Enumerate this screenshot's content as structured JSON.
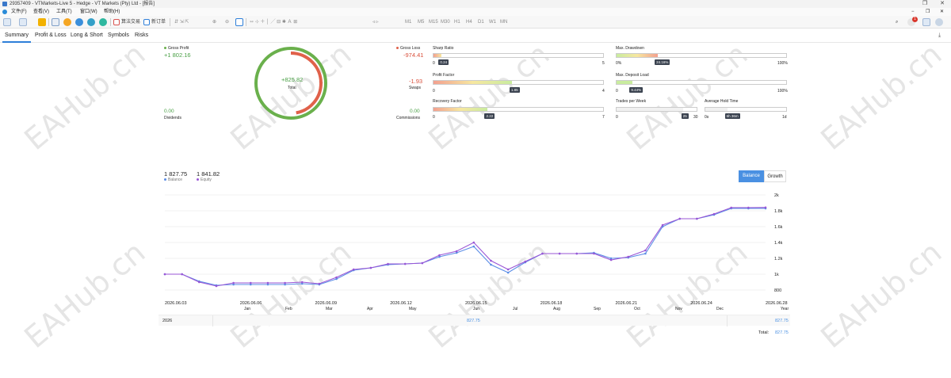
{
  "window": {
    "title": "29357409 - VTMarkets-Live 5 - Hedge - VT Markets (Pty) Ltd - [报告]",
    "buttons": [
      "❐",
      "✕"
    ]
  },
  "menu": {
    "items": [
      "文件(F)",
      "查看(V)",
      "工具(T)",
      "窗口(W)",
      "帮助(H)"
    ],
    "right_controls": [
      "−",
      "❐",
      "✕"
    ]
  },
  "toolbar": {
    "algo_label": "算法交易",
    "new_order_label": "新订单",
    "timeframes": [
      "M1",
      "M5",
      "M15",
      "M30",
      "H1",
      "H4",
      "D1",
      "W1",
      "MN"
    ],
    "notification_count": "1"
  },
  "tabs": [
    "Summary",
    "Profit & Loss",
    "Long & Short",
    "Symbols",
    "Risks"
  ],
  "summary": {
    "gross_profit_label": "Gross Profit",
    "gross_profit_value": "+1 802.16",
    "gross_loss_label": "Gross Loss",
    "gross_loss_value": "-974.41",
    "total_value": "+825.82",
    "total_label": "Total",
    "dividends_value": "0.00",
    "dividends_label": "Dividends",
    "swaps_value": "-1.93",
    "swaps_label": "Swaps",
    "commissions_value": "0.00",
    "commissions_label": "Commissions",
    "ring_profit_fraction": 0.649
  },
  "metrics": {
    "sharp_ratio": {
      "label": "Sharp Ratio",
      "value": "0.24",
      "min": "0",
      "max": "5",
      "fraction": 0.048
    },
    "profit_factor": {
      "label": "Profit Factor",
      "value": "1.85",
      "min": "0",
      "max": "4",
      "fraction": 0.4625
    },
    "recovery_factor": {
      "label": "Recovery Factor",
      "value": "2.22",
      "min": "0",
      "max": "7",
      "fraction": 0.317
    },
    "max_drawdown": {
      "label": "Max. Drawdown",
      "value": "24.16%",
      "min": "0%",
      "max": "100%",
      "fraction": 0.2416
    },
    "max_deposit_load": {
      "label": "Max. Deposit Load",
      "value": "9.44%",
      "min": "0",
      "max": "100%",
      "fraction": 0.0944
    },
    "trades_per_week": {
      "label": "Trades per Week",
      "value": "25",
      "min": "0",
      "max": "30",
      "fraction": 0.833
    },
    "average_hold_time": {
      "label": "Average Hold Time",
      "value": "6h 36m",
      "min": "0s",
      "max": "1d",
      "fraction": 0.275
    }
  },
  "legend": {
    "balance_value": "1 827.75",
    "balance_label": "Balance",
    "equity_value": "1 841.82",
    "equity_label": "Equity"
  },
  "chart_toggle": {
    "balance": "Balance",
    "growth": "Growth"
  },
  "chart_data": {
    "type": "line",
    "y_ticks": [
      "800",
      "1k",
      "1.2k",
      "1.4k",
      "1.6k",
      "1.8k",
      "2k"
    ],
    "ylim": [
      800,
      2000
    ],
    "x_ticks": [
      "2026.06.03",
      "2026.06.06",
      "2026.06.09",
      "2026.06.12",
      "2026.06.15",
      "2026.06.18",
      "2026.06.21",
      "2026.06.24",
      "2026.06.28"
    ],
    "series": [
      {
        "name": "Balance",
        "color": "#5b8de6",
        "values": [
          1000,
          1000,
          910,
          860,
          870,
          870,
          870,
          870,
          880,
          870,
          940,
          1050,
          1080,
          1120,
          1130,
          1140,
          1220,
          1270,
          1350,
          1120,
          1020,
          1150,
          1260,
          1260,
          1260,
          1270,
          1200,
          1210,
          1260,
          1600,
          1700,
          1700,
          1750,
          1830,
          1830,
          1830
        ]
      },
      {
        "name": "Equity",
        "color": "#9a56d6",
        "values": [
          1000,
          1000,
          900,
          850,
          890,
          890,
          890,
          890,
          900,
          880,
          960,
          1060,
          1080,
          1130,
          1130,
          1140,
          1240,
          1290,
          1400,
          1170,
          1060,
          1160,
          1260,
          1260,
          1260,
          1260,
          1180,
          1220,
          1300,
          1620,
          1700,
          1700,
          1760,
          1840,
          1840,
          1842
        ]
      }
    ]
  },
  "months_row": [
    "Jan",
    "Feb",
    "Mar",
    "Apr",
    "May",
    "Jun",
    "Jul",
    "Aug",
    "Sep",
    "Oct",
    "Nov",
    "Dec",
    "Year"
  ],
  "year_row": {
    "year": "2026",
    "june_value": "827.75",
    "year_total": "827.75"
  },
  "total_row": {
    "label": "Total:",
    "value": "827.75"
  },
  "watermark_text": "EAHub.cn",
  "colors": {
    "profit": "#6ab04c",
    "loss": "#e0614a",
    "accent": "#2e7fd9",
    "toggle_active": "#4a90e2"
  }
}
